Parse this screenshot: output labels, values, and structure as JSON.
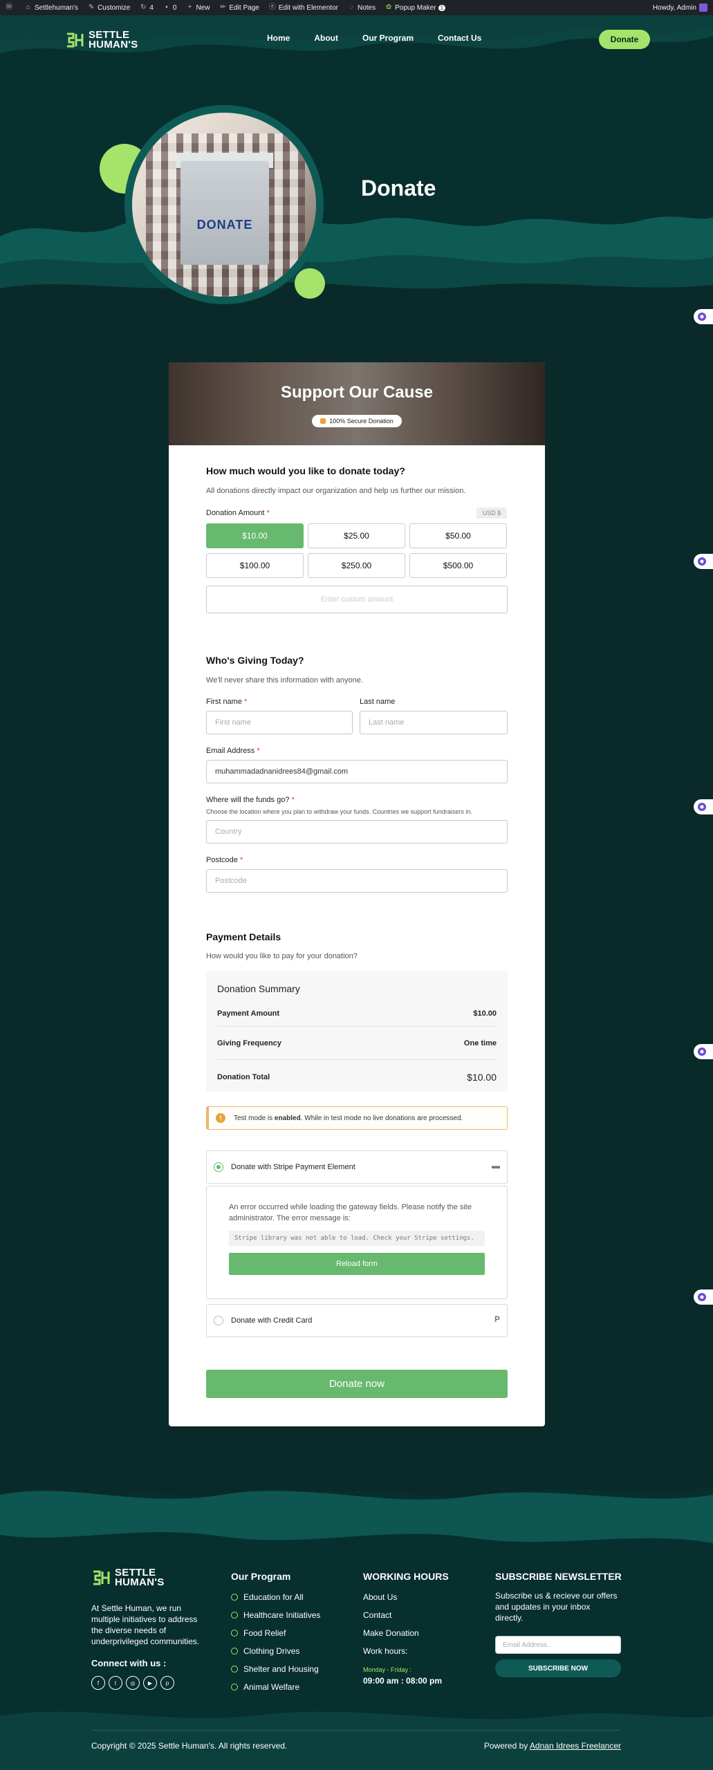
{
  "adminbar": {
    "items": [
      {
        "icon": "wordpress-icon",
        "label": ""
      },
      {
        "icon": "home-icon",
        "label": "Settlehuman's"
      },
      {
        "icon": "brush-icon",
        "label": "Customize"
      },
      {
        "icon": "updates-icon",
        "label": "4"
      },
      {
        "icon": "comment-icon",
        "label": "0"
      },
      {
        "icon": "plus-icon",
        "label": "New"
      },
      {
        "icon": "pencil-icon",
        "label": "Edit Page"
      },
      {
        "icon": "elementor-icon",
        "label": "Edit with Elementor"
      },
      {
        "icon": "notes-icon",
        "label": "Notes"
      },
      {
        "icon": "popup-icon",
        "label": "Popup Maker"
      }
    ],
    "popup_badge": "1",
    "howdy": "Howdy, Admin"
  },
  "site": {
    "logo_line1": "SETTLE",
    "logo_line2": "HUMAN'S",
    "nav": [
      "Home",
      "About",
      "Our Program",
      "Contact Us"
    ],
    "nav_donate": "Donate"
  },
  "hero": {
    "title": "Donate",
    "box_label": "DONATE"
  },
  "form": {
    "header_title": "Support Our Cause",
    "secure_badge": "100% Secure Donation",
    "amount_section": {
      "title": "How much would you like to donate today?",
      "subtitle": "All donations directly impact our organization and help us further our mission.",
      "label": "Donation Amount",
      "required": "*",
      "currency": "USD  $",
      "amounts": [
        "$10.00",
        "$25.00",
        "$50.00",
        "$100.00",
        "$250.00",
        "$500.00"
      ],
      "selected_index": 0,
      "custom_placeholder": "Enter custom amount"
    },
    "donor_section": {
      "title": "Who's Giving Today?",
      "subtitle": "We'll never share this information with anyone.",
      "first_name_label": "First name",
      "first_name_placeholder": "First name",
      "last_name_label": "Last name",
      "last_name_placeholder": "Last name",
      "email_label": "Email Address",
      "email_value": "muhammadadnanidrees84@gmail.com",
      "funds_label": "Where will the funds go?",
      "funds_help": "Choose the location where you plan to withdraw your funds. Countries we support fundraisers in.",
      "country_placeholder": "Country",
      "postcode_label": "Postcode",
      "postcode_placeholder": "Postcode",
      "required": "*"
    },
    "payment_section": {
      "title": "Payment Details",
      "subtitle": "How would you like to pay for your donation?",
      "summary_title": "Donation Summary",
      "payment_amount_label": "Payment Amount",
      "payment_amount_value": "$10.00",
      "frequency_label": "Giving Frequency",
      "frequency_value": "One time",
      "total_label": "Donation Total",
      "total_value": "$10.00",
      "notice_prefix": "Test mode is ",
      "notice_bold": "enabled",
      "notice_suffix": ". While in test mode no live donations are processed.",
      "gateway_stripe": "Donate with Stripe Payment Element",
      "error_text": "An error occurred while loading the gateway fields. Please notify the site administrator. The error message is:",
      "error_code": "Stripe library was not able to load.  Check your Stripe settings.",
      "reload_label": "Reload form",
      "gateway_card": "Donate with Credit Card",
      "submit_label": "Donate now"
    }
  },
  "footer": {
    "about": "At Settle Human, we run multiple initiatives to address the diverse needs of underprivileged communities.",
    "connect": "Connect with us :",
    "socials": [
      "facebook-icon",
      "twitter-icon",
      "instagram-icon",
      "youtube-icon",
      "pinterest-icon"
    ],
    "program_title": "Our Program",
    "program_items": [
      "Education for All",
      "Healthcare Initiatives",
      "Food Relief",
      "Clothing Drives",
      "Shelter and Housing",
      "Animal Welfare"
    ],
    "hours_title": "WORKING HOURS",
    "hours_links": [
      "About Us",
      "Contact",
      "Make Donation",
      "Work hours:"
    ],
    "hours_days": "Monday - Friday :",
    "hours_time": "09:00 am : 08:00 pm",
    "news_title": "SUBSCRIBE NEWSLETTER",
    "news_text": "Subscribe us & recieve our offers and updates in your inbox directly.",
    "email_placeholder": "Email Address..",
    "subscribe_label": "SUBSCRIBE NOW",
    "copyright": "Copyright © 2025 Settle Human's. All rights reserved.",
    "powered_prefix": "Powered by ",
    "powered_link": "Adnan Idrees Freelancer"
  },
  "colors": {
    "dark_teal": "#072f2e",
    "teal": "#0e5b56",
    "lime": "#a6e36a",
    "green_button": "#67b96e"
  }
}
